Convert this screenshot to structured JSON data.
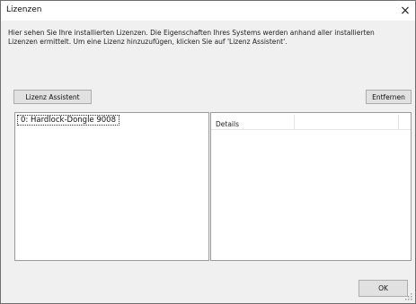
{
  "window": {
    "title": "Lizenzen",
    "close_label": "×"
  },
  "intro": "Hier sehen Sie Ihre installierten Lizenzen. Die Eigenschaften Ihres Systems werden anhand aller installierten Lizenzen ermittelt. Um eine Lizenz hinzuzufügen, klicken Sie auf 'Lizenz Assistent'.",
  "toolbar": {
    "assistant_label": "Lizenz Assistent",
    "remove_label": "Entfernen"
  },
  "licenses": {
    "items": [
      {
        "label": "0: Hardlock-Dongle 9008"
      }
    ]
  },
  "details": {
    "header": "Details"
  },
  "footer": {
    "ok_label": "OK"
  },
  "icons": {
    "close": "close-icon",
    "grip": "resize-grip-icon"
  }
}
